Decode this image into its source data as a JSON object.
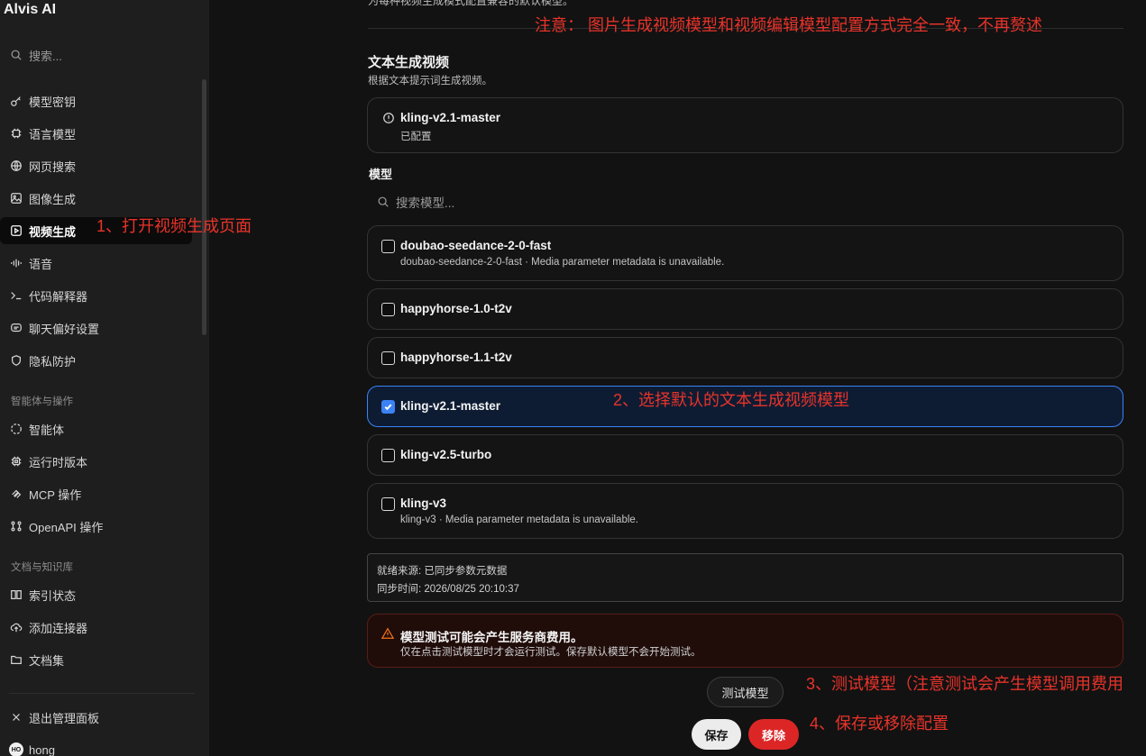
{
  "app": {
    "title": "Alvis AI"
  },
  "sidebar": {
    "search_placeholder": "搜索...",
    "items": [
      {
        "label": "模型密钥",
        "icon": "key-icon"
      },
      {
        "label": "语言模型",
        "icon": "chip-icon"
      },
      {
        "label": "网页搜索",
        "icon": "globe-icon"
      },
      {
        "label": "图像生成",
        "icon": "image-icon"
      },
      {
        "label": "视频生成",
        "icon": "video-icon",
        "active": true
      },
      {
        "label": "语音",
        "icon": "waveform-icon"
      },
      {
        "label": "代码解释器",
        "icon": "terminal-icon"
      },
      {
        "label": "聊天偏好设置",
        "icon": "chat-icon"
      },
      {
        "label": "隐私防护",
        "icon": "shield-icon"
      }
    ],
    "section_agents": "智能体与操作",
    "agent_items": [
      {
        "label": "智能体",
        "icon": "agent-icon"
      },
      {
        "label": "运行时版本",
        "icon": "runtime-icon"
      },
      {
        "label": "MCP 操作",
        "icon": "mcp-icon"
      },
      {
        "label": "OpenAPI 操作",
        "icon": "openapi-icon"
      }
    ],
    "section_docs": "文档与知识库",
    "doc_items": [
      {
        "label": "索引状态",
        "icon": "book-icon"
      },
      {
        "label": "添加连接器",
        "icon": "cloud-upload-icon"
      },
      {
        "label": "文档集",
        "icon": "folder-icon"
      }
    ],
    "exit_label": "退出管理面板",
    "user": {
      "initials": "HO",
      "name": "hong"
    }
  },
  "main": {
    "top_cut_text": "为每种视频生成模式配置兼容的默认模型。",
    "section_title": "文本生成视频",
    "section_subtitle": "根据文本提示词生成视频。",
    "configured": {
      "name": "kling-v2.1-master",
      "status": "已配置"
    },
    "models_label": "模型",
    "model_search_placeholder": "搜索模型...",
    "models": [
      {
        "name": "doubao-seedance-2-0-fast",
        "desc": "doubao-seedance-2-0-fast · Media parameter metadata is unavailable.",
        "checked": false
      },
      {
        "name": "happyhorse-1.0-t2v",
        "desc": "",
        "checked": false
      },
      {
        "name": "happyhorse-1.1-t2v",
        "desc": "",
        "checked": false
      },
      {
        "name": "kling-v2.1-master",
        "desc": "",
        "checked": true
      },
      {
        "name": "kling-v2.5-turbo",
        "desc": "",
        "checked": false
      },
      {
        "name": "kling-v3",
        "desc": "kling-v3 · Media parameter metadata is unavailable.",
        "checked": false
      }
    ],
    "status": {
      "source": "就绪来源: 已同步参数元数据",
      "sync_time": "同步时间: 2026/08/25 20:10:37"
    },
    "warning": {
      "title": "模型测试可能会产生服务商费用。",
      "text": "仅在点击测试模型时才会运行测试。保存默认模型不会开始测试。"
    },
    "buttons": {
      "test": "测试模型",
      "save": "保存",
      "remove": "移除"
    }
  },
  "annotations": {
    "note": "注意： 图片生成视频模型和视频编辑模型配置方式完全一致，不再赘述",
    "step1": "1、打开视频生成页面",
    "step2": "2、选择默认的文本生成视频模型",
    "step3": "3、测试模型（注意测试会产生模型调用费用",
    "step4": "4、保存或移除配置"
  },
  "colors": {
    "accent": "#3b82f6",
    "danger": "#dc2626",
    "annotation": "#e8332a",
    "warning": "#f97316"
  }
}
